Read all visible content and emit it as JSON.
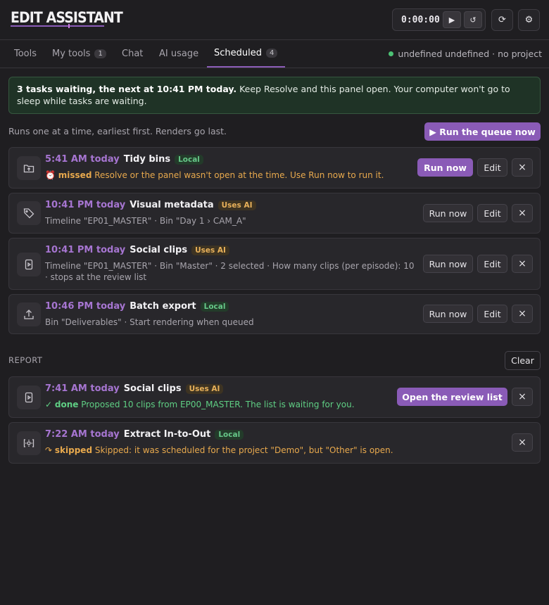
{
  "header": {
    "logo_text": "EDIT ASSISTANT",
    "timer": "0:00:00",
    "play_icon": "▶",
    "reset_icon": "↺",
    "refresh_icon": "⟳",
    "settings_icon": "⚙"
  },
  "tabs": [
    {
      "label": "Tools",
      "badge": null
    },
    {
      "label": "My tools",
      "badge": "1"
    },
    {
      "label": "Chat",
      "badge": null
    },
    {
      "label": "AI usage",
      "badge": null
    },
    {
      "label": "Scheduled",
      "badge": "4",
      "active": true
    }
  ],
  "project_status": "undefined undefined · no project",
  "banner": {
    "bold": "3 tasks waiting, the next at 10:41 PM today.",
    "text": " Keep Resolve and this panel open. Your computer won't go to sleep while tasks are waiting."
  },
  "hint": "Runs one at a time, earliest first. Renders go last.",
  "run_queue_label": "▶ Run the queue now",
  "tasks": [
    {
      "time": "5:41 AM today",
      "name": "Tidy bins",
      "tag": "Local",
      "status_icon": "⏰",
      "status": "missed",
      "detail": " Resolve or the panel wasn't open at the time. Use Run now to run it.",
      "run_label": "Run now",
      "edit_label": "Edit",
      "close_label": "×",
      "icon": "folder-up-icon"
    },
    {
      "time": "10:41 PM today",
      "name": "Visual metadata",
      "tag": "Uses AI",
      "detail": "Timeline \"EP01_MASTER\" · Bin \"Day 1 › CAM_A\"",
      "run_label": "Run now",
      "edit_label": "Edit",
      "close_label": "×",
      "icon": "tag-icon"
    },
    {
      "time": "10:41 PM today",
      "name": "Social clips",
      "tag": "Uses AI",
      "detail": "Timeline \"EP01_MASTER\" · Bin \"Master\" · 2 selected · How many clips (per episode): 10 · stops at the review list",
      "run_label": "Run now",
      "edit_label": "Edit",
      "close_label": "×",
      "icon": "phone-video-icon"
    },
    {
      "time": "10:46 PM today",
      "name": "Batch export",
      "tag": "Local",
      "detail": "Bin \"Deliverables\" · Start rendering when queued",
      "run_label": "Run now",
      "edit_label": "Edit",
      "close_label": "×",
      "icon": "upload-icon"
    }
  ],
  "report": {
    "label": "REPORT",
    "clear_label": "Clear",
    "items": [
      {
        "time": "7:41 AM today",
        "name": "Social clips",
        "tag": "Uses AI",
        "status_icon": "✓",
        "status": "done",
        "detail": " Proposed 10 clips from EP00_MASTER. The list is waiting for you.",
        "action_label": "Open the review list",
        "close_label": "×",
        "icon": "phone-video-icon"
      },
      {
        "time": "7:22 AM today",
        "name": "Extract In-to-Out",
        "tag": "Local",
        "status_icon": "↷",
        "status": "skipped",
        "detail": " Skipped: it was scheduled for the project \"Demo\", but \"Other\" is open.",
        "close_label": "×",
        "icon": "extract-icon"
      }
    ]
  },
  "colors": {
    "accent": "#8a5bb7",
    "time": "#a675d1",
    "ok": "#5fcf84",
    "warn": "#e8a94d"
  }
}
